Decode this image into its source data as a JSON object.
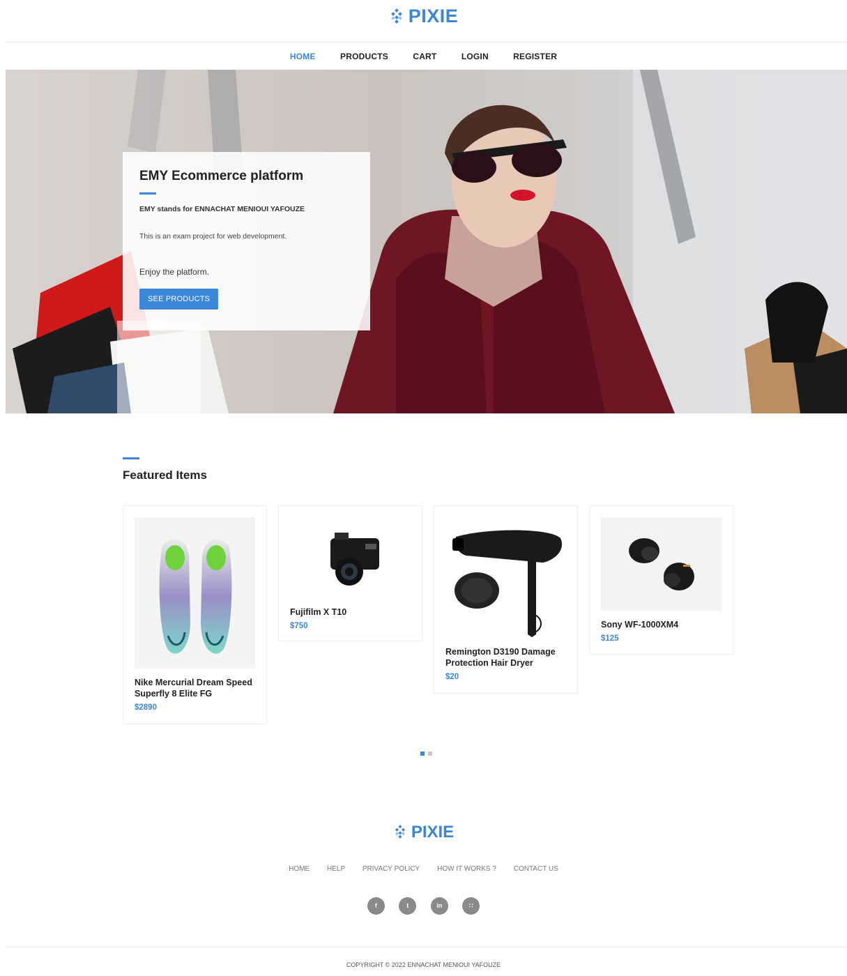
{
  "brand": {
    "name": "PIXIE",
    "color": "#3b86d6",
    "icon": "diamond-grid-logo-icon"
  },
  "nav": {
    "items": [
      {
        "label": "HOME",
        "active": true
      },
      {
        "label": "PRODUCTS",
        "active": false
      },
      {
        "label": "CART",
        "active": false
      },
      {
        "label": "LOGIN",
        "active": false
      },
      {
        "label": "REGISTER",
        "active": false
      }
    ]
  },
  "hero": {
    "title": "EMY Ecommerce platform",
    "subtitle": "EMY stands for ENNACHAT MENIOUI YAFOUZE",
    "text1": "This is an exam project for web development.",
    "text2": "Enjoy the platform.",
    "button_label": "SEE PRODUCTS",
    "image": "woman-with-shopping-bags-photo"
  },
  "featured": {
    "title": "Featured Items",
    "products": [
      {
        "name": "Nike Mercurial Dream Speed Superfly 8 Elite FG",
        "price": "$2890",
        "image": "football-boots-image"
      },
      {
        "name": "Fujifilm X T10",
        "price": "$750",
        "image": "camera-image"
      },
      {
        "name": "Remington D3190 Damage Protection Hair Dryer",
        "price": "$20",
        "image": "hair-dryer-image"
      },
      {
        "name": "Sony WF-1000XM4",
        "price": "$125",
        "image": "wireless-earbuds-image"
      }
    ],
    "carousel": {
      "pages": 2,
      "active_page": 1
    }
  },
  "footer": {
    "links": [
      "HOME",
      "HELP",
      "PRIVACY POLICY",
      "HOW IT WORKS ?",
      "CONTACT US"
    ],
    "social": [
      {
        "icon": "facebook-icon",
        "glyph": "f"
      },
      {
        "icon": "twitter-icon",
        "glyph": "t"
      },
      {
        "icon": "linkedin-icon",
        "glyph": "in"
      },
      {
        "icon": "rss-icon",
        "glyph": "∷"
      }
    ],
    "copyright": "COPYRIGHT © 2022 ENNACHAT MENIOUI YAFOUZE"
  }
}
